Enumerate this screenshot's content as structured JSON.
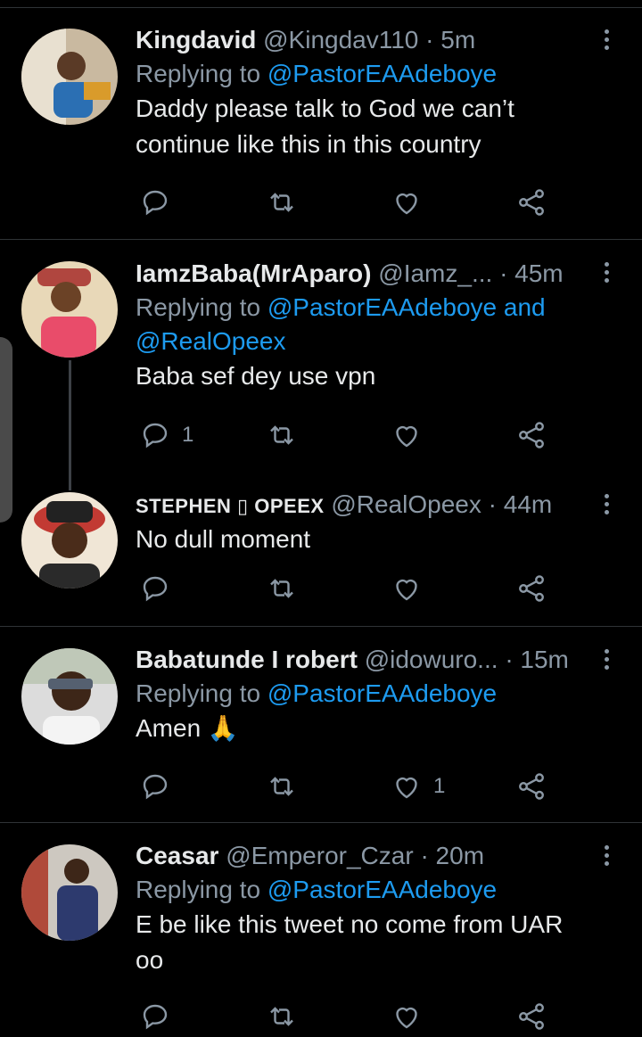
{
  "tweets": [
    {
      "name": "Kingdavid",
      "handle": "@Kingdav110",
      "time": "· 5m",
      "replying_prefix": "Replying to",
      "mentions": "@PastorEAAdeboye",
      "mentions2": "",
      "text": "Daddy please talk to God we can’t continue like this in this country",
      "reply_count": "",
      "retweet_count": "",
      "like_count": ""
    },
    {
      "name": "IamzBaba(MrAparo)",
      "handle": "@Iamz_...",
      "time": "· 45m",
      "replying_prefix": "Replying to",
      "mentions": "@PastorEAAdeboye and",
      "mentions2": "@RealOpeex",
      "text": "Baba sef dey use vpn",
      "reply_count": "1",
      "retweet_count": "",
      "like_count": ""
    },
    {
      "name": "STEPHEN ▯ OPEEX",
      "handle": "@RealOpeex",
      "time": "· 44m",
      "replying_prefix": "",
      "mentions": "",
      "mentions2": "",
      "text": "No dull moment",
      "reply_count": "",
      "retweet_count": "",
      "like_count": ""
    },
    {
      "name": "Babatunde I robert",
      "handle": "@idowuro...",
      "time": "· 15m",
      "replying_prefix": "Replying to",
      "mentions": "@PastorEAAdeboye",
      "mentions2": "",
      "text": "Amen 🙏",
      "reply_count": "",
      "retweet_count": "",
      "like_count": "1"
    },
    {
      "name": "Ceasar",
      "handle": "@Emperor_Czar",
      "time": "· 20m",
      "replying_prefix": "Replying to",
      "mentions": "@PastorEAAdeboye",
      "mentions2": "",
      "text": "E be like this tweet no come from UAR oo",
      "reply_count": "",
      "retweet_count": "",
      "like_count": ""
    }
  ],
  "icons": {
    "reply": "reply-icon",
    "retweet": "retweet-icon",
    "like": "heart-icon",
    "share": "share-icon",
    "more": "more-vertical-icon"
  },
  "colors": {
    "background": "#000000",
    "text": "#e7e9ea",
    "secondary": "#8b98a5",
    "mention": "#1d9bf0",
    "divider": "#2f3336"
  }
}
